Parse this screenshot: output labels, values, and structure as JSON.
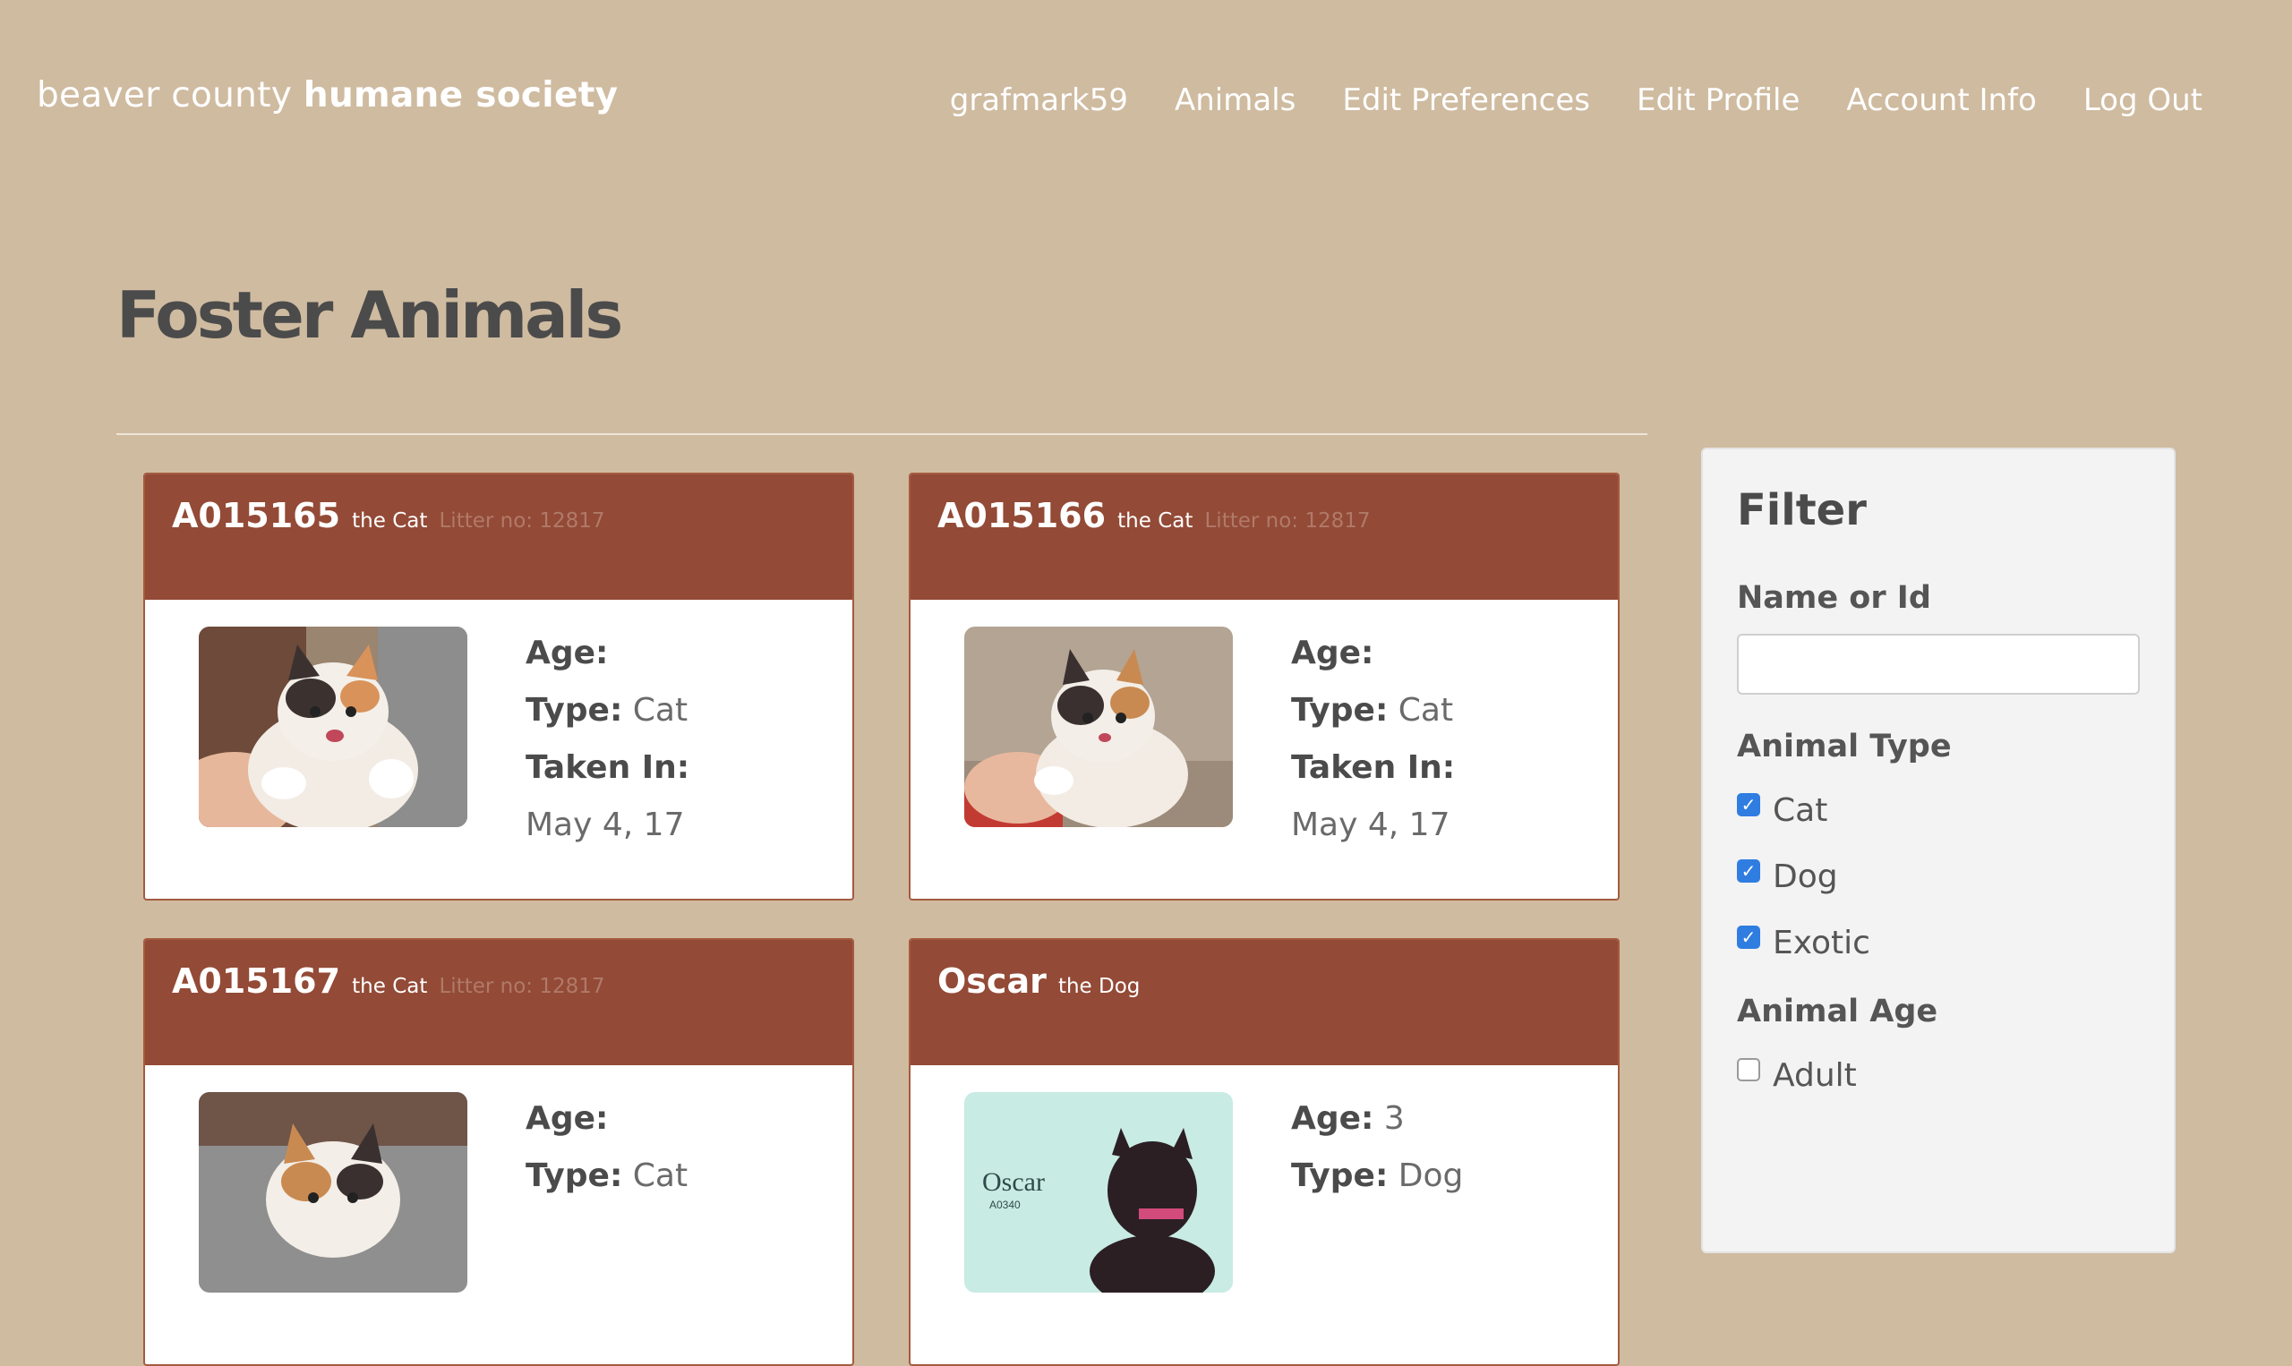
{
  "header": {
    "brand_light": "beaver county",
    "brand_strong": "humane society",
    "nav": [
      "grafmark59",
      "Animals",
      "Edit Preferences",
      "Edit Profile",
      "Account Info",
      "Log Out"
    ]
  },
  "page": {
    "title": "Foster Animals"
  },
  "cards": [
    {
      "name": "A015165",
      "kind": "the Cat",
      "litter": "Litter no: 12817",
      "age_label": "Age:",
      "age_value": "",
      "type_label": "Type:",
      "type_value": "Cat",
      "taken_label": "Taken In:",
      "taken_value": "May 4, 17"
    },
    {
      "name": "A015166",
      "kind": "the Cat",
      "litter": "Litter no: 12817",
      "age_label": "Age:",
      "age_value": "",
      "type_label": "Type:",
      "type_value": "Cat",
      "taken_label": "Taken In:",
      "taken_value": "May 4, 17"
    },
    {
      "name": "A015167",
      "kind": "the Cat",
      "litter": "Litter no: 12817",
      "age_label": "Age:",
      "age_value": "",
      "type_label": "Type:",
      "type_value": "Cat"
    },
    {
      "name": "Oscar",
      "kind": "the Dog",
      "litter": "",
      "age_label": "Age:",
      "age_value": "3",
      "type_label": "Type:",
      "type_value": "Dog",
      "photo_caption": "Oscar",
      "photo_subcaption": "A0340"
    }
  ],
  "filter": {
    "title": "Filter",
    "name_label": "Name or Id",
    "name_value": "",
    "type_label": "Animal Type",
    "types": [
      {
        "label": "Cat",
        "checked": true
      },
      {
        "label": "Dog",
        "checked": true
      },
      {
        "label": "Exotic",
        "checked": true
      }
    ],
    "age_label": "Animal Age",
    "ages": [
      {
        "label": "Adult",
        "checked": false
      }
    ]
  }
}
